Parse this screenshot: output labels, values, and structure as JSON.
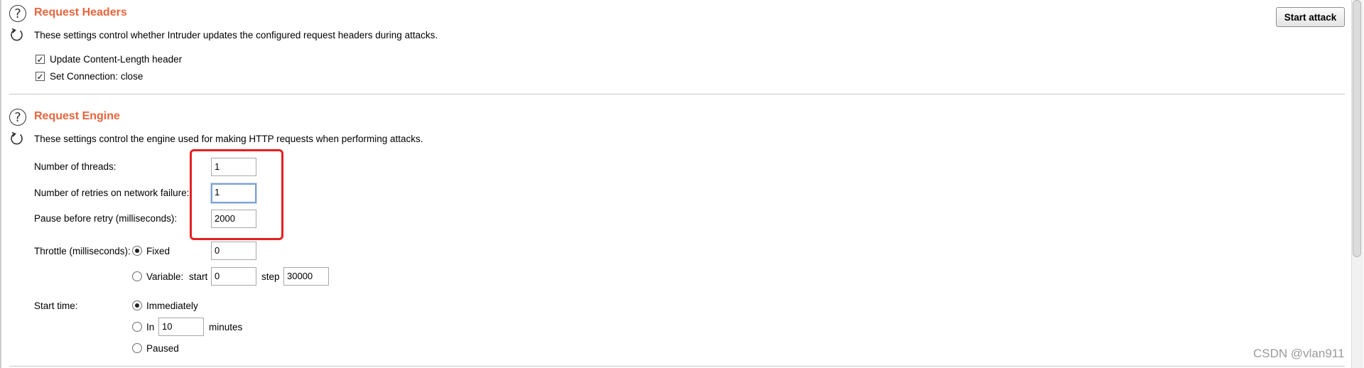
{
  "request_headers": {
    "title": "Request Headers",
    "description": "These settings control whether Intruder updates the configured request headers during attacks.",
    "options": [
      {
        "label": "Update Content-Length header",
        "checked": true
      },
      {
        "label": "Set Connection: close",
        "checked": true
      }
    ]
  },
  "toolbar": {
    "start_attack_label": "Start attack"
  },
  "request_engine": {
    "title": "Request Engine",
    "description": "These settings control the engine used for making HTTP requests when performing attacks.",
    "threads": {
      "label": "Number of threads:",
      "value": "1"
    },
    "retries": {
      "label": "Number of retries on network failure:",
      "value": "1"
    },
    "pause": {
      "label": "Pause before retry (milliseconds):",
      "value": "2000"
    },
    "throttle": {
      "label": "Throttle (milliseconds):",
      "fixed_label": "Fixed",
      "fixed_value": "0",
      "variable_label": "Variable:",
      "start_label": "start",
      "start_value": "0",
      "step_label": "step",
      "step_value": "30000",
      "selected": "Fixed"
    },
    "start_time": {
      "label": "Start time:",
      "immediately_label": "Immediately",
      "in_label": "In",
      "in_value": "10",
      "minutes_label": "minutes",
      "paused_label": "Paused",
      "selected": "Immediately"
    }
  },
  "watermark": "CSDN @vlan911",
  "icons": {
    "help": "help-icon",
    "refresh": "refresh-icon"
  },
  "colors": {
    "section_title": "#e8643c",
    "highlight": "#e52020",
    "focus": "#7ba2d3"
  }
}
